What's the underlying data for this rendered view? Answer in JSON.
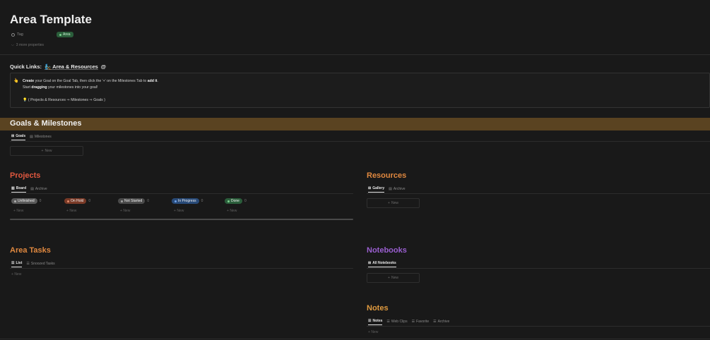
{
  "page": {
    "title": "Area Template",
    "tag_label": "Tag",
    "tag_value": "Area",
    "more_properties": "3 more properties"
  },
  "quick_links": {
    "label": "Quick Links:",
    "link_icon": "🧞",
    "link_text": "Area & Resources",
    "at_symbol": "@"
  },
  "callout": {
    "icon": "👆",
    "line1_pre": "Create",
    "line1_mid": " your Goal on the Goal Tab, then click the '+' on the Milestones Tab to ",
    "line1_bold": "add it",
    "line1_end": ".",
    "line2_pre": "Start ",
    "line2_bold": "dragging",
    "line2_end": " your milestones into your goal!",
    "hint_icon": "💡",
    "flow": "( Projects & Resources ⇒ Milestones ⇒ Goals )"
  },
  "goals": {
    "title": "Goals & Milestones",
    "tabs": [
      {
        "label": "Goals",
        "icon": "grid-icon",
        "active": true
      },
      {
        "label": "Milestones",
        "icon": "table-icon",
        "active": false
      }
    ],
    "new_label": "New"
  },
  "projects": {
    "title": "Projects",
    "color": "#e0583f",
    "tabs": [
      {
        "label": "Board",
        "icon": "board-icon",
        "active": true
      },
      {
        "label": "Archive",
        "icon": "table-icon",
        "active": false
      }
    ],
    "statuses": [
      {
        "label": "Unfinished",
        "count": "0",
        "bg": "#5a5a5a",
        "dot": "#b0b0b0"
      },
      {
        "label": "On Hold",
        "count": "0",
        "bg": "#7a3a27",
        "dot": "#e08a6a"
      },
      {
        "label": "Not Started",
        "count": "0",
        "bg": "#4a4a4a",
        "dot": "#a0a0a0"
      },
      {
        "label": "In Progress",
        "count": "0",
        "bg": "#284a78",
        "dot": "#6da0e8"
      },
      {
        "label": "Done",
        "count": "0",
        "bg": "#2b5e3b",
        "dot": "#7ad08e"
      }
    ],
    "new_label": "New"
  },
  "resources": {
    "title": "Resources",
    "color": "#e0883f",
    "tabs": [
      {
        "label": "Gallery",
        "icon": "grid-icon",
        "active": true
      },
      {
        "label": "Archive",
        "icon": "table-icon",
        "active": false
      }
    ],
    "new_label": "New"
  },
  "area_tasks": {
    "title": "Area Tasks",
    "color": "#e0883f",
    "tabs": [
      {
        "label": "List",
        "icon": "list-icon",
        "active": true
      },
      {
        "label": "Snoozed Tasks",
        "icon": "list-icon",
        "active": false
      }
    ],
    "new_label": "New"
  },
  "notebooks": {
    "title": "Notebooks",
    "color": "#9a5fd0",
    "tabs": [
      {
        "label": "All Notebooks",
        "icon": "grid-icon",
        "active": true
      }
    ],
    "new_label": "New"
  },
  "notes": {
    "title": "Notes",
    "color": "#e09a3f",
    "tabs": [
      {
        "label": "Notes",
        "icon": "list-icon",
        "active": true
      },
      {
        "label": "Web Clips",
        "icon": "list-icon",
        "active": false
      },
      {
        "label": "Favorite",
        "icon": "list-icon",
        "active": false
      },
      {
        "label": "Archive",
        "icon": "list-icon",
        "active": false
      }
    ],
    "new_label": "New"
  }
}
